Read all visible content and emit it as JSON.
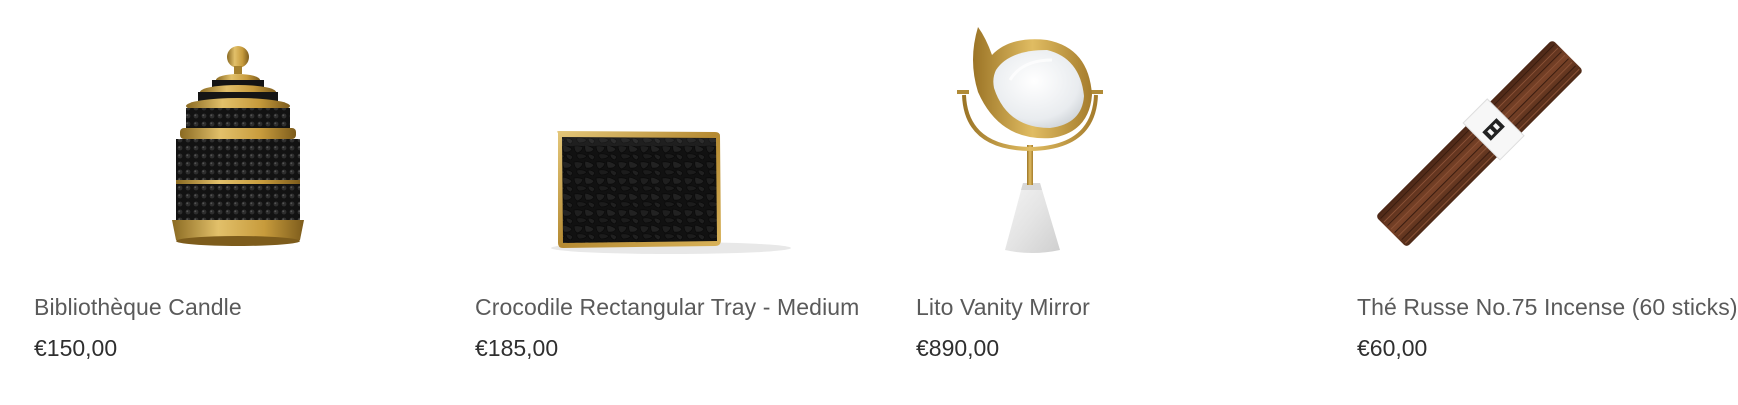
{
  "products": [
    {
      "name": "Bibliothèque Candle",
      "price": "€150,00",
      "image_icon": "candle-jar-icon"
    },
    {
      "name": "Crocodile Rectangular Tray - Medium",
      "price": "€185,00",
      "image_icon": "tray-icon"
    },
    {
      "name": "Lito Vanity Mirror",
      "price": "€890,00",
      "image_icon": "vanity-mirror-icon"
    },
    {
      "name": "Thé Russe No.75 Incense (60 sticks)",
      "price": "€60,00",
      "image_icon": "incense-sticks-icon"
    }
  ],
  "colors": {
    "gold": "#c9a24a",
    "black": "#141414",
    "name_text": "#5a5a5a",
    "price_text": "#2f2f2f",
    "incense_brown": "#6b3a22"
  }
}
